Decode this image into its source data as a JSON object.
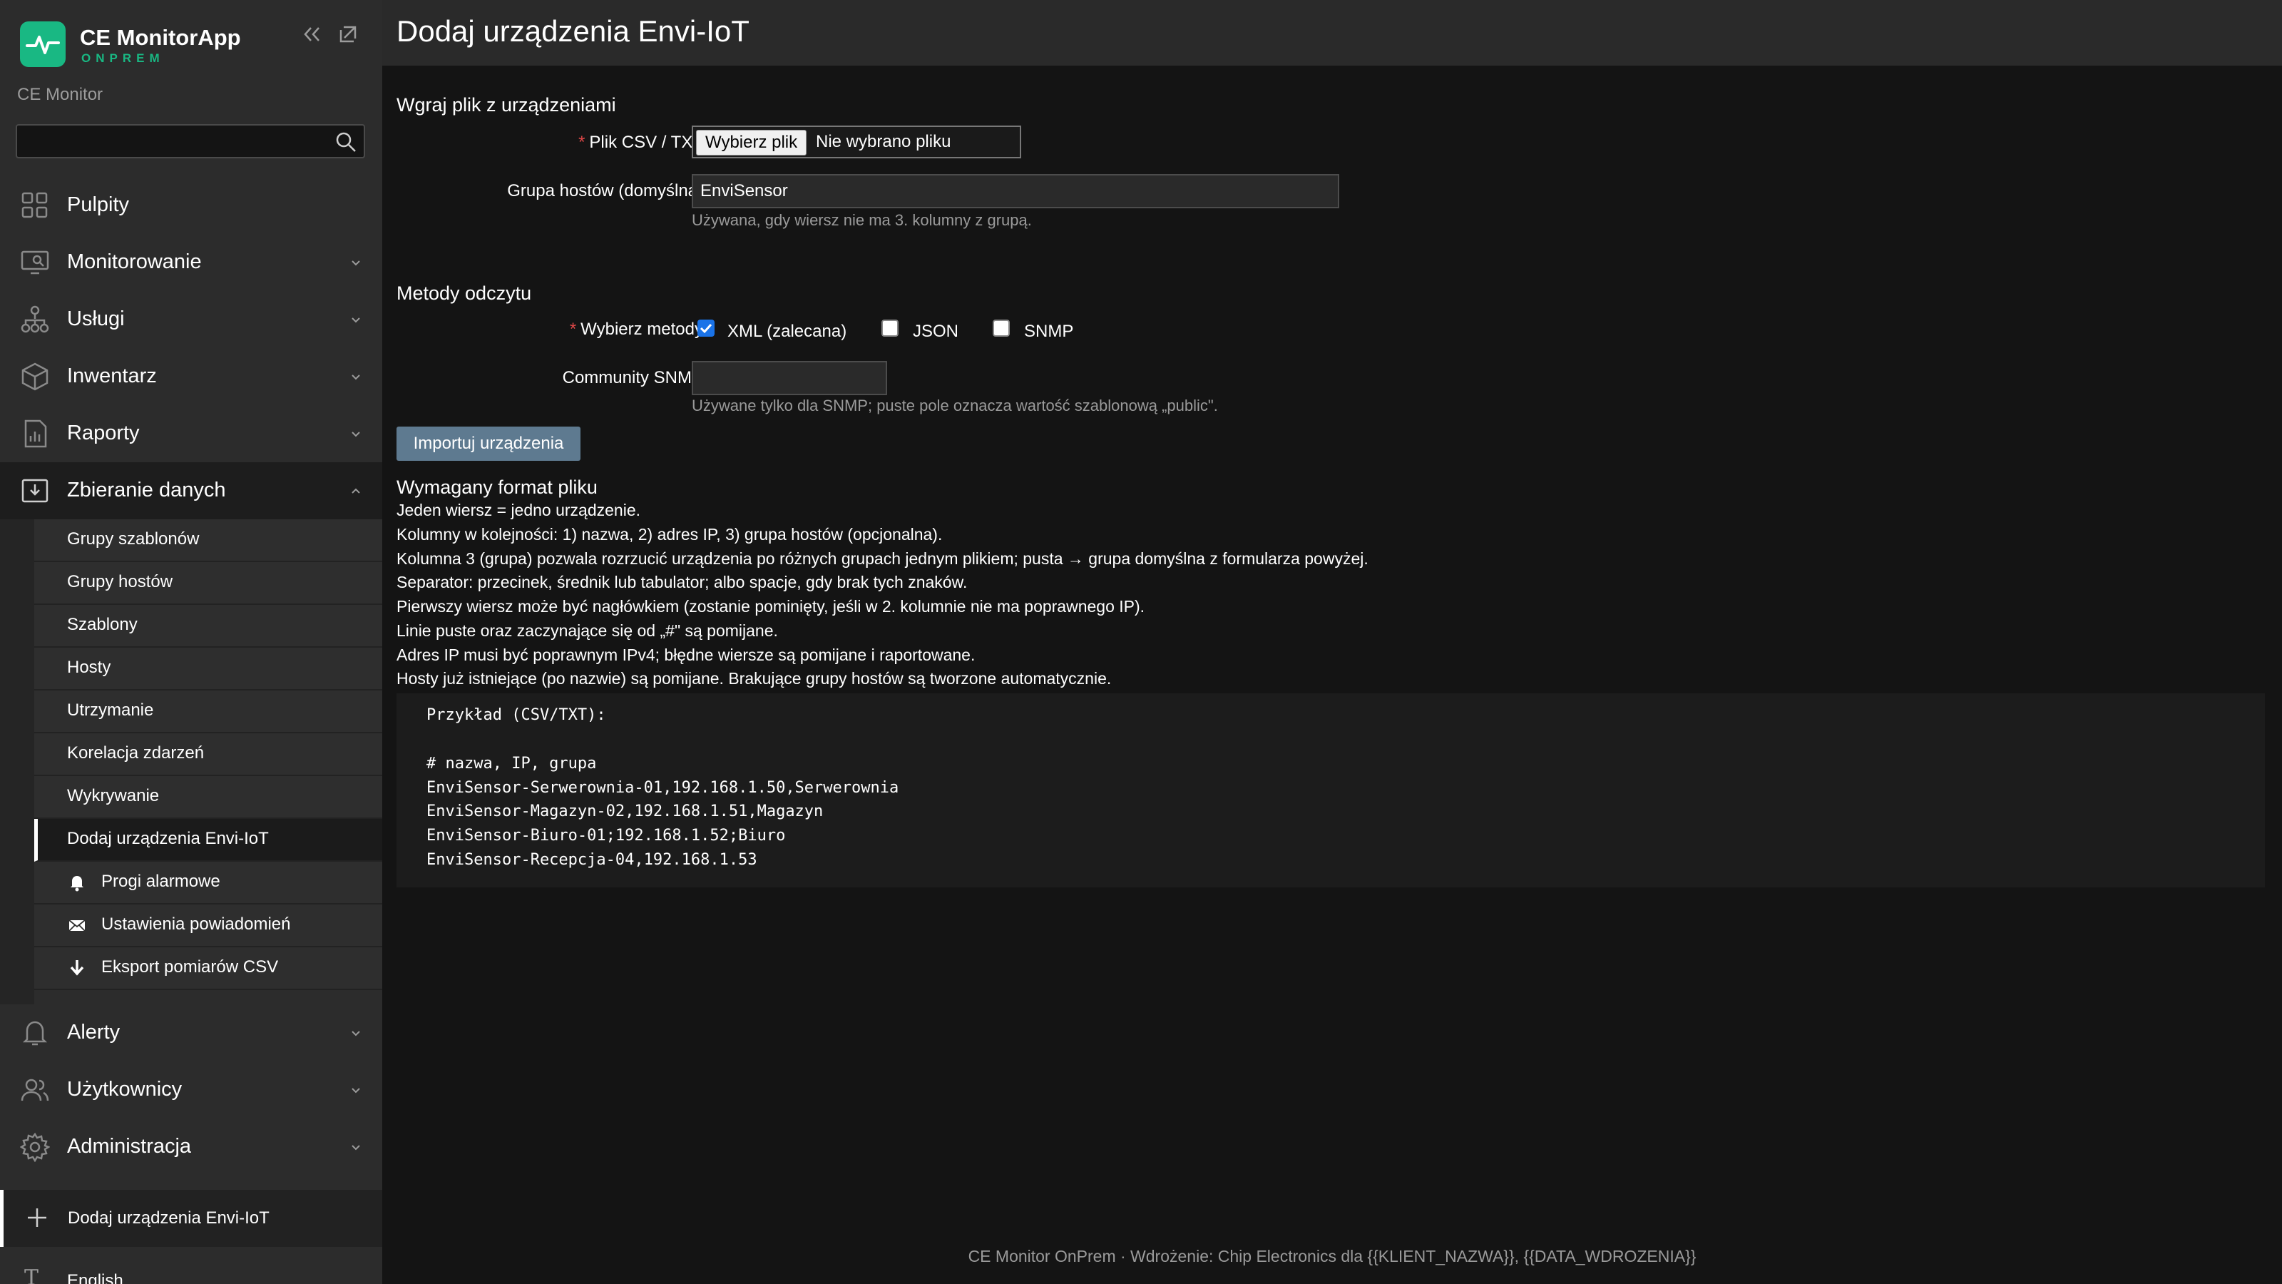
{
  "brand": {
    "title": "CE MonitorApp",
    "subtitle": "ONPREM",
    "accent": "#19b883"
  },
  "breadcrumb": "CE Monitor",
  "search": {
    "value": "",
    "placeholder": ""
  },
  "nav": {
    "items": [
      {
        "label": "Pulpity",
        "icon": "dashboard-icon"
      },
      {
        "label": "Monitorowanie",
        "icon": "monitor-icon"
      },
      {
        "label": "Usługi",
        "icon": "services-icon"
      },
      {
        "label": "Inwentarz",
        "icon": "box-icon"
      },
      {
        "label": "Raporty",
        "icon": "report-icon"
      },
      {
        "label": "Zbieranie danych",
        "icon": "download-icon"
      },
      {
        "label": "Alerty",
        "icon": "bell-icon"
      },
      {
        "label": "Użytkownicy",
        "icon": "users-icon"
      },
      {
        "label": "Administracja",
        "icon": "gear-icon"
      }
    ],
    "submenu": [
      "Grupy szablonów",
      "Grupy hostów",
      "Szablony",
      "Hosty",
      "Utrzymanie",
      "Korelacja zdarzeń",
      "Wykrywanie",
      "Dodaj urządzenia Envi-IoT",
      "Progi alarmowe",
      "Ustawienia powiadomień",
      "Eksport pomiarów CSV"
    ],
    "active_submenu": "Dodaj urządzenia Envi-IoT",
    "pinned": "Dodaj urządzenia Envi-IoT",
    "language": {
      "icon_letter": "T",
      "label": "English"
    }
  },
  "page": {
    "title": "Dodaj urządzenia Envi-IoT",
    "upload": {
      "section_title": "Wgraj plik z urządzeniami",
      "file_label": "Plik CSV / TXT",
      "file_button": "Wybierz plik",
      "file_status": "Nie wybrano pliku",
      "group_label": "Grupa hostów (domyślna)",
      "group_value": "EnviSensor",
      "group_help": "Używana, gdy wiersz nie ma 3. kolumny z grupą."
    },
    "methods": {
      "section_title": "Metody odczytu",
      "label": "Wybierz metody",
      "options": [
        {
          "label": "XML (zalecana)",
          "checked": true
        },
        {
          "label": "JSON",
          "checked": false
        },
        {
          "label": "SNMP",
          "checked": false
        }
      ],
      "community_label": "Community SNMP",
      "community_value": "",
      "community_help": "Używane tylko dla SNMP; puste pole oznacza wartość szablonową „public\"."
    },
    "import_button": "Importuj urządzenia",
    "format": {
      "title": "Wymagany format pliku",
      "lines": [
        "Jeden wiersz = jedno urządzenie.",
        "Kolumny w kolejności: 1) nazwa, 2) adres IP, 3) grupa hostów (opcjonalna).",
        "Kolumna 3 (grupa) pozwala rozrzucić urządzenia po różnych grupach jednym plikiem; pusta → grupa domyślna z formularza powyżej.",
        "Separator: przecinek, średnik lub tabulator; albo spacje, gdy brak tych znaków.",
        "Pierwszy wiersz może być nagłówkiem (zostanie pominięty, jeśli w 2. kolumnie nie ma poprawnego IP).",
        "Linie puste oraz zaczynające się od „#\" są pomijane.",
        "Adres IP musi być poprawnym IPv4; błędne wiersze są pomijane i raportowane.",
        "Hosty już istniejące (po nazwie) są pomijane. Brakujące grupy hostów są tworzone automatycznie."
      ],
      "example_title": "Przykład (CSV/TXT):",
      "example_lines": [
        "# nazwa, IP, grupa",
        "EnviSensor-Serwerownia-01,192.168.1.50,Serwerownia",
        "EnviSensor-Magazyn-02,192.168.1.51,Magazyn",
        "EnviSensor-Biuro-01;192.168.1.52;Biuro",
        "EnviSensor-Recepcja-04,192.168.1.53"
      ]
    },
    "footer": "CE Monitor OnPrem · Wdrożenie: Chip Electronics dla {{KLIENT_NAZWA}}, {{DATA_WDROZENIA}}"
  }
}
